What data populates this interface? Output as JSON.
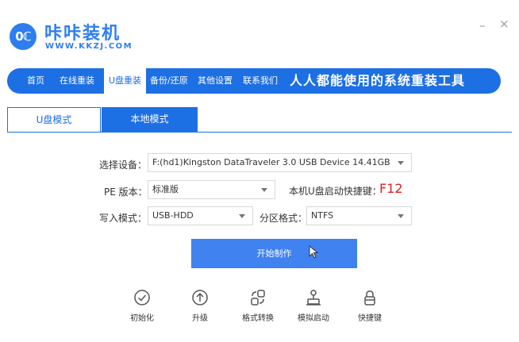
{
  "header": {
    "logo_text": "0ℂ",
    "brand_cn": "咔咔装机",
    "brand_url": "WWW.KKZJ.COM",
    "minimize": "–",
    "close": "×"
  },
  "nav": {
    "items": [
      {
        "label": "首页"
      },
      {
        "label": "在线重装"
      },
      {
        "label": "U盘重装"
      },
      {
        "label": "备份/还原"
      },
      {
        "label": "其他设置"
      },
      {
        "label": "联系我们"
      }
    ],
    "active_index": 2,
    "slogan": "人人都能使用的系统重装工具"
  },
  "tabs": [
    {
      "label": "U盘模式"
    },
    {
      "label": "本地模式"
    }
  ],
  "form": {
    "device_label": "选择设备：",
    "device_value": "F:(hd1)Kingston DataTraveler 3.0 USB Device 14.41GB",
    "pe_label": "PE 版本：",
    "pe_value": "标准版",
    "hotkey_label": "本机U盘启动快捷键：",
    "hotkey_value": "F12",
    "write_label": "写入模式：",
    "write_value": "USB-HDD",
    "partition_label": "分区格式：",
    "partition_value": "NTFS"
  },
  "start_button": "开始制作",
  "tools": [
    {
      "label": "初始化",
      "icon": "check-circle-icon"
    },
    {
      "label": "升级",
      "icon": "arrow-up-circle-icon"
    },
    {
      "label": "格式转换",
      "icon": "convert-icon"
    },
    {
      "label": "模拟启动",
      "icon": "simulate-boot-icon"
    },
    {
      "label": "快捷键",
      "icon": "key-lock-icon"
    }
  ],
  "colors": {
    "accent": "#1d6fe4",
    "button": "#3f82f0",
    "hotkey": "#e02020"
  }
}
